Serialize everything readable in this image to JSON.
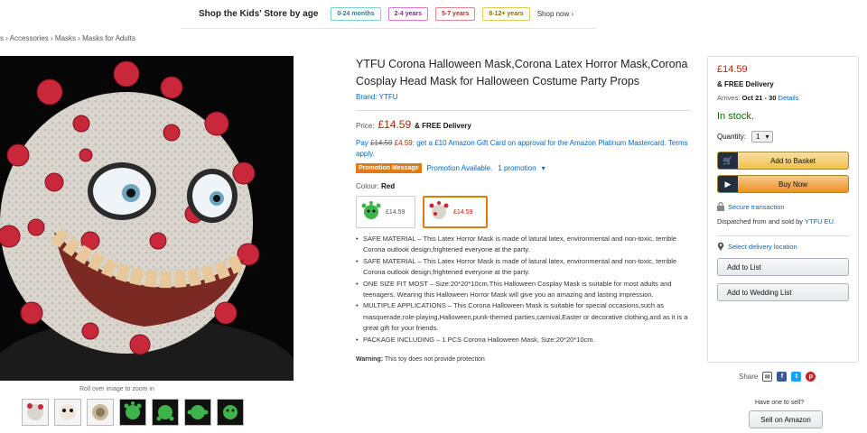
{
  "kids_bar": {
    "title": "Shop the Kids' Store by age",
    "chips": [
      "0-24 months",
      "2-4 years",
      "5-7 years",
      "8-12+ years"
    ],
    "shop_now": "Shop now ›"
  },
  "breadcrumb": "s › Accessories › Masks › Masks for Adults",
  "gallery": {
    "zoom_hint": "Roll over image to zoom in",
    "thumbnail_count": 7
  },
  "product": {
    "title": "YTFU Corona Halloween Mask,Corona Latex Horror Mask,Corona Cosplay Head Mask for Halloween Costume Party Props",
    "brand": "Brand: YTFU",
    "price_label": "Price:",
    "price": "£14.59",
    "price_suffix": "& FREE Delivery",
    "promo_pay": "Pay",
    "promo_old": "£14.59",
    "promo_new": "£4.59",
    "promo_text": ": get a £10 Amazon Gift Card on approval for the Amazon Platinum Mastercard. Terms apply.",
    "promo_badge": "Promotion Message",
    "promo_available": "Promotion Available.",
    "promo_count": "1 promotion",
    "colour_label": "Colour:",
    "colour_value": "Red",
    "swatches": [
      {
        "price": "£14.59"
      },
      {
        "price": "£14.59"
      }
    ],
    "bullets": [
      "SAFE MATERIAL – This Latex Horror Mask is made of latural latex, environmental and non-toxic, terrible Corona outlook design,frightened everyone at the party.",
      "SAFE MATERIAL – This Latex Horror Mask is made of latural latex, environmental and non-toxic, terrible Corona outlook design,frightened everyone at the party.",
      "ONE SIZE FIT MOST – Size:20*20*10cm.This Halloween Cosplay Mask is suitable for most adults and teenagers. Wearing this Halloween Horror Mask will give you an amazing and lasting impression.",
      "MULTIPLE APPLICATIONS – This Corona Halloween Mask is suitable for special occasions,such as masquerade,role-playing,Halloween,punk-themed parties,carnival,Easter or decorative clothing,and as it is a great gift for your friends.",
      "PACKAGE INCLUDING – 1 PCS Corona Halloween Mask, Size:20*20*10cm."
    ],
    "warning_label": "Warning:",
    "warning_text": "This toy does not provide protection"
  },
  "buybox": {
    "price": "£14.59",
    "free_delivery": "& FREE Delivery",
    "arrives_label": "Arrives:",
    "arrives_date": "Oct 21 - 30",
    "details_link": "Details",
    "stock": "In stock.",
    "quantity_label": "Quantity:",
    "quantity_value": "1",
    "add_to_basket": "Add to Basket",
    "buy_now": "Buy Now",
    "secure": "Secure transaction",
    "dispatched_text": "Dispatched from and sold by",
    "seller": "YTFU EU.",
    "delivery_location": "Select delivery location",
    "add_to_list": "Add to List",
    "add_to_wedding_list": "Add to Wedding List"
  },
  "share": {
    "label": "Share"
  },
  "sell": {
    "prompt": "Have one to sell?",
    "button": "Sell on Amazon"
  },
  "colors": {
    "link": "#0066c0",
    "price": "#b12704",
    "stock": "#007600",
    "promo_badge": "#e47911"
  }
}
